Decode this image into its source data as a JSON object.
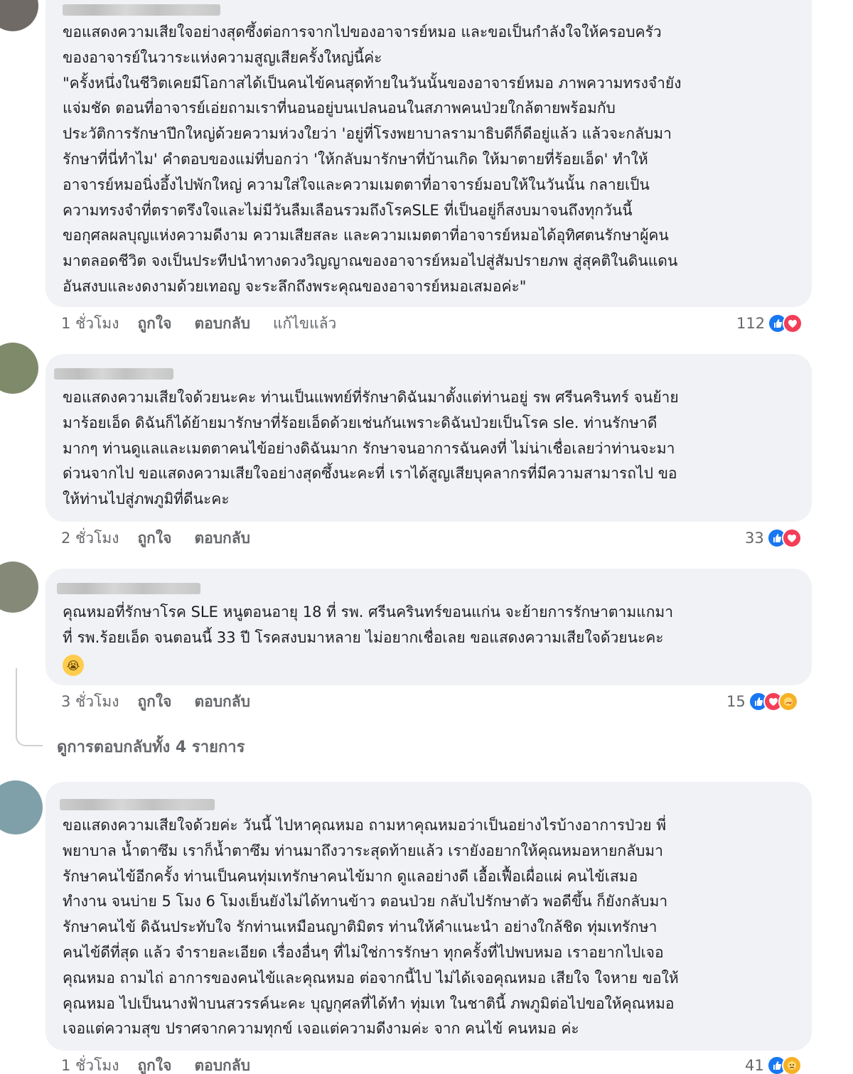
{
  "comments": [
    {
      "text": "ขอแสดงความเสียใจอย่างสุดซึ้งต่อการจากไปของอาจารย์หมอ และขอเป็นกำลังใจให้ครอบครัว\nของอาจารย์ในวาระแห่งความสูญเสียครั้งใหญ่นี้ค่ะ\n\"ครั้งหนึ่งในชีวิตเคยมีโอกาสได้เป็นคนไข้คนสุดท้ายในวันนั้นของอาจารย์หมอ ภาพความทรงจำยัง\nแจ่มชัด ตอนที่อาจารย์เอ่ยถามเราที่นอนอยู่บนเปลนอนในสภาพคนป่วยใกล้ตายพร้อมกับ\nประวัติการรักษาปึกใหญ่ด้วยความห่วงใยว่า 'อยู่ที่โรงพยาบาลรามาธิบดีก็ดีอยู่แล้ว แล้วจะกลับมา\nรักษาที่นี่ทำไม' คำตอบของแม่ที่บอกว่า 'ให้กลับมารักษาที่บ้านเกิด ให้มาตายที่ร้อยเอ็ด' ทำให้\nอาจารย์หมอนิ่งอึ้งไปพักใหญ่ ความใส่ใจและความเมตตาที่อาจารย์มอบให้ในวันนั้น กลายเป็น\nความทรงจำที่ตราตรึงใจและไม่มีวันลืมเลือนรวมถึงโรคSLE ที่เป็นอยู่ก็สงบมาจนถึงทุกวันนี้\nขอกุศลผลบุญแห่งความดีงาม ความเสียสละ และความเมตตาที่อาจารย์หมอได้อุทิศตนรักษาผู้คน\nมาตลอดชีวิต จงเป็นประทีปนำทางดวงวิญญาณของอาจารย์หมอไปสู่สัมปรายภพ สู่สุคติในดินแดน\nอันสงบและงดงามด้วยเทอญ จะระลึกถึงพระคุณของอาจารย์หมอเสมอค่ะ\"",
      "time": "1 ชั่วโมง",
      "like_label": "ถูกใจ",
      "reply_label": "ตอบกลับ",
      "edited_label": "แก้ไขแล้ว",
      "reaction_count": "112"
    },
    {
      "text": "ขอแสดงความเสียใจด้วยนะคะ ท่านเป็นแพทย์ที่รักษาดิฉันมาตั้งแต่ท่านอยู่ รพ ศรีนครินทร์ จนย้าย\nมาร้อยเอ็ด ดิฉันก็ได้ย้ายมารักษาที่ร้อยเอ็ดด้วยเช่นกันเพราะดิฉันป่วยเป็นโรค sle. ท่านรักษาดี\nมากๆ ท่านดูแลและเมตตาคนไข้อย่างดิฉันมาก รักษาจนอาการฉันคงที่ ไม่น่าเชื่อเลยว่าท่านจะมา\nด่วนจากไป ขอแสดงความเสียใจอย่างสุดซึ้งนะคะที่ เราได้สูญเสียบุคลากรที่มีความสามารถไป ขอ\nให้ท่านไปสู่ภพภูมิที่ดีนะคะ",
      "time": "2 ชั่วโมง",
      "like_label": "ถูกใจ",
      "reply_label": "ตอบกลับ",
      "reaction_count": "33"
    },
    {
      "text": "คุณหมอที่รักษาโรค SLE หนูตอนอายุ 18 ที่ รพ. ศรีนครินทร์ขอนแก่น จะย้ายการรักษาตามแกมา\nที่ รพ.ร้อยเอ็ด จนตอนนี้ 33 ปี โรคสงบมาหลาย ไม่อยากเชื่อเลย ขอแสดงความเสียใจด้วยนะคะ",
      "time": "3 ชั่วโมง",
      "like_label": "ถูกใจ",
      "reply_label": "ตอบกลับ",
      "reaction_count": "15"
    },
    {
      "text": "ขอแสดงความเสียใจด้วยค่ะ วันนี้ ไปหาคุณหมอ ถามหาคุณหมอว่าเป็นอย่างไรบ้างอาการป่วย พี่\nพยาบาล น้ำตาซึม เราก็น้ำตาซึม ท่านมาถึงวาระสุดท้ายแล้ว เรายังอยากให้คุณหมอหายกลับมา\nรักษาคนไข้อีกครั้ง ท่านเป็นคนทุ่มเทรักษาคนไข้มาก ดูแลอย่างดี เอื้อเฟื้อเผื่อแผ่ คนไข้เสมอ\nทำงาน จนบ่าย 5 โมง 6 โมงเย็นยังไม่ได้ทานข้าว ตอนป่วย กลับไปรักษาตัว พอดีขึ้น ก็ยังกลับมา\nรักษาคนไข้ ดิฉันประทับใจ รักท่านเหมือนญาติมิตร ท่านให้คำแนะนำ อย่างใกล้ชิด ทุ่มเทรักษา\nคนไข้ดีที่สุด แล้ว จำรายละเอียด เรื่องอื่นๆ ที่ไม่ใช่การรักษา ทุกครั้งที่ไปพบหมอ เราอยากไปเจอ\nคุณหมอ ถามไถ่ อาการของคนไข้และคุณหมอ ต่อจากนี้ไป ไม่ได้เจอคุณหมอ เสียใจ ใจหาย ขอให้\nคุณหมอ ไปเป็นนางฟ้าบนสวรรค์นะคะ บุญกุศลที่ได้ทำ ทุ่มเท ในชาตินี้ ภพภูมิต่อไปขอให้คุณหมอ\nเจอแต่ความสุข ปราศจากความทุกข์ เจอแต่ความดีงามค่ะ จาก คนไข้ คนหมอ ค่ะ",
      "time": "1 ชั่วโมง",
      "like_label": "ถูกใจ",
      "reply_label": "ตอบกลับ",
      "reaction_count": "41"
    }
  ],
  "view_replies": "ดูการตอบกลับทั้ง 4 รายการ",
  "icons": {
    "like": "like-reaction-icon",
    "love": "love-reaction-icon",
    "care": "care-reaction-icon",
    "sad": "sad-reaction-icon",
    "crying_emoji": "crying-emoji-icon"
  },
  "colors": {
    "bubble": "#f0f2f5",
    "like": "#1877f2",
    "love": "#f33e58",
    "secondary_text": "#65676b"
  }
}
